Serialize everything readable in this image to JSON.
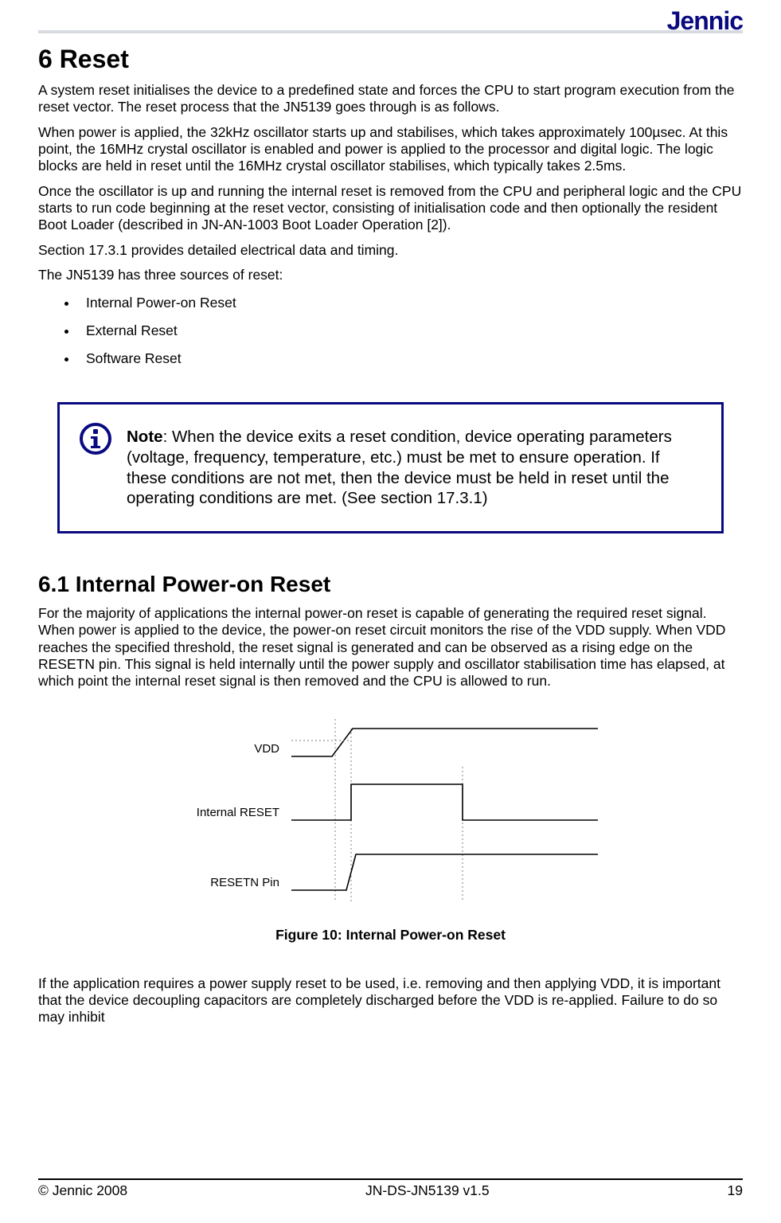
{
  "brand": "Jennic",
  "h1": "6 Reset",
  "paras": {
    "p1": "A system reset initialises the device to a predefined state and forces the CPU to start program execution from the reset vector.  The reset process that the JN5139 goes through is as follows.",
    "p2a": "When power is applied, the 32kHz oscillator starts up and stabilises, which takes approximately 100",
    "p2b": "sec.  At this point, the 16MHz crystal oscillator is enabled and power is applied to the processor and digital logic. The logic blocks are held in reset until the 16MHz crystal oscillator stabilises, which typically takes 2.5ms.",
    "micro": "µ",
    "p3": "Once the oscillator is up and running the internal reset is removed from the CPU and peripheral logic and the CPU starts to run code beginning at the reset vector, consisting of initialisation code and then optionally the resident Boot Loader (described in JN-AN-1003 Boot Loader Operation [2]).",
    "p4": "Section 17.3.1 provides detailed electrical data and timing.",
    "p5": "The JN5139 has three sources of reset:"
  },
  "bullets": [
    "Internal Power-on Reset",
    "External Reset",
    "Software Reset"
  ],
  "note": {
    "label": "Note",
    "body": ": When the device exits a reset condition, device operating parameters (voltage, frequency, temperature, etc.) must be met to ensure operation. If these conditions are not met, then the device must be held in reset until the operating conditions are met. (See section 17.3.1)"
  },
  "h2": "6.1  Internal Power-on Reset",
  "p6": "For the majority of applications the internal power-on reset is capable of generating the required reset signal. When power is applied to the device, the power-on reset circuit monitors the rise of the VDD supply. When VDD reaches the specified threshold, the reset signal is generated and can be observed as a rising edge on the RESETN pin. This signal is held internally until the power supply and oscillator stabilisation time has elapsed, at which point the internal reset signal is then removed and the CPU is allowed to run.",
  "figure": {
    "signals": {
      "s1": "VDD",
      "s2": "Internal RESET",
      "s3": "RESETN Pin"
    },
    "caption": "Figure 10: Internal Power-on Reset"
  },
  "p7": "If the application requires a power supply reset to be used, i.e. removing and then applying VDD, it is important that the device decoupling capacitors are completely discharged before the VDD is re-applied. Failure to do so may inhibit",
  "footer": {
    "left": "© Jennic 2008",
    "center": "JN-DS-JN5139 v1.5",
    "right": "19"
  }
}
